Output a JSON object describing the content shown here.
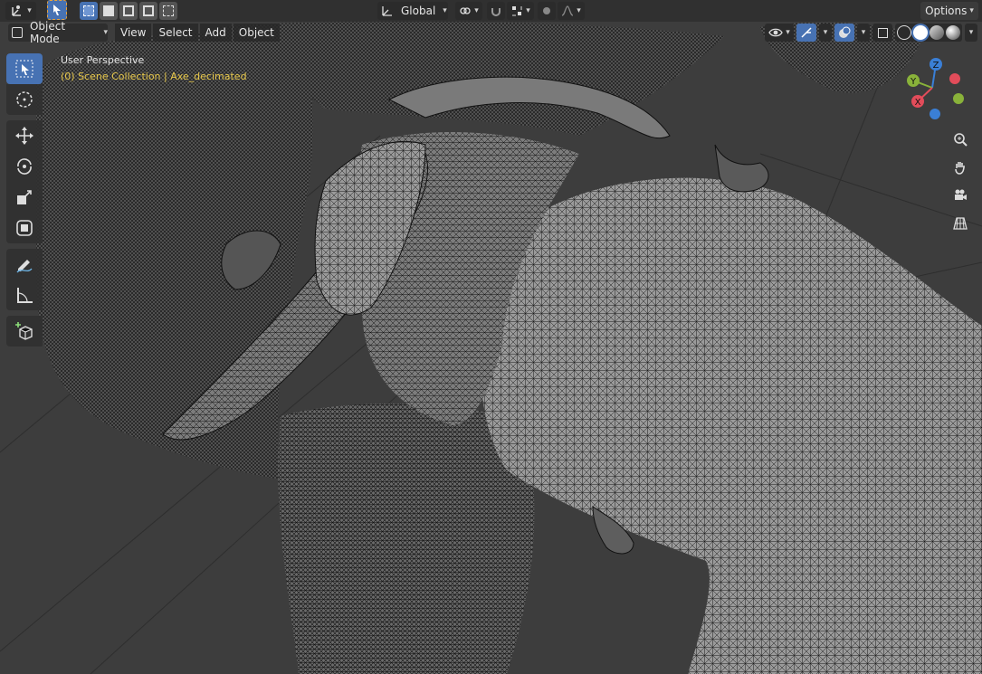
{
  "header": {
    "orientation": "Global",
    "options_label": "Options"
  },
  "viewport_header": {
    "mode": "Object Mode",
    "menus": [
      "View",
      "Select",
      "Add",
      "Object"
    ]
  },
  "overlay": {
    "perspective": "User Perspective",
    "collection": "(0) Scene Collection | Axe_decimated",
    "collection_color": "#e8c84a"
  },
  "gizmo": {
    "axes": [
      "Z",
      "Y",
      "X"
    ],
    "colors": {
      "x": "#e24c5a",
      "y": "#89b23a",
      "z": "#3a7fd6"
    }
  },
  "toolbar": {
    "tools": [
      "select-box-tool",
      "cursor-tool",
      "move-tool",
      "rotate-tool",
      "scale-tool",
      "transform-tool",
      "annotate-tool",
      "measure-tool",
      "add-cube-tool"
    ],
    "active": "select-box-tool"
  },
  "theme": {
    "accent": "#4772b3",
    "viewport_bg": "#3d3d3d",
    "header_bg": "#303030"
  }
}
